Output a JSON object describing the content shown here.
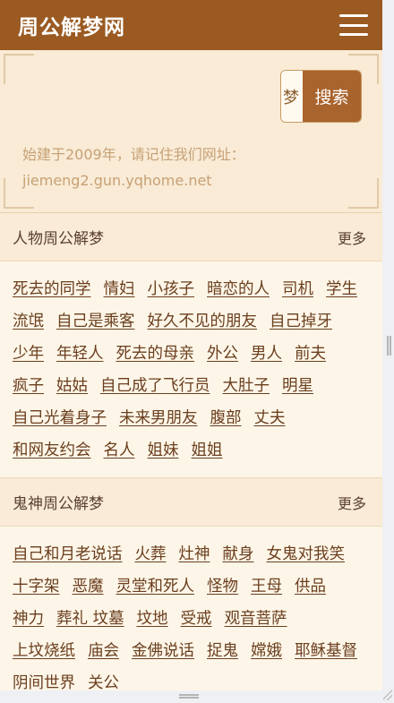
{
  "header": {
    "title": "周公解梦网",
    "menu_icon": "hamburger-menu-icon"
  },
  "search": {
    "value": "梦",
    "button_label": "搜索"
  },
  "notice": {
    "line1": "始建于2009年，请记住我们网址：",
    "line2": "jiemeng2.gun.yqhome.net"
  },
  "sections": [
    {
      "title": "人物周公解梦",
      "more_label": "更多",
      "links": [
        "死去的同学",
        "情妇",
        "小孩子",
        "暗恋的人",
        "司机",
        "学生",
        "流氓",
        "自己是乘客",
        "好久不见的朋友",
        "自己掉牙",
        "少年",
        "年轻人",
        "死去的母亲",
        "外公",
        "男人",
        "前夫",
        "疯子",
        "姑姑",
        "自己成了飞行员",
        "大肚子",
        "明星",
        "自己光着身子",
        "未来男朋友",
        "腹部",
        "丈夫",
        "和网友约会",
        "名人",
        "姐妹",
        "姐姐"
      ]
    },
    {
      "title": "鬼神周公解梦",
      "more_label": "更多",
      "links": [
        "自己和月老说话",
        "火葬",
        "灶神",
        "献身",
        "女鬼对我笑",
        "十字架",
        "恶魔",
        "灵堂和死人",
        "怪物",
        "王母",
        "供品",
        "神力",
        "葬礼 坟墓",
        "坟地",
        "受戒",
        "观音菩萨",
        "上坟烧纸",
        "庙会",
        "金佛说话",
        "捉鬼",
        "嫦娥",
        "耶稣基督",
        "阴间世界",
        "关公"
      ]
    }
  ]
}
